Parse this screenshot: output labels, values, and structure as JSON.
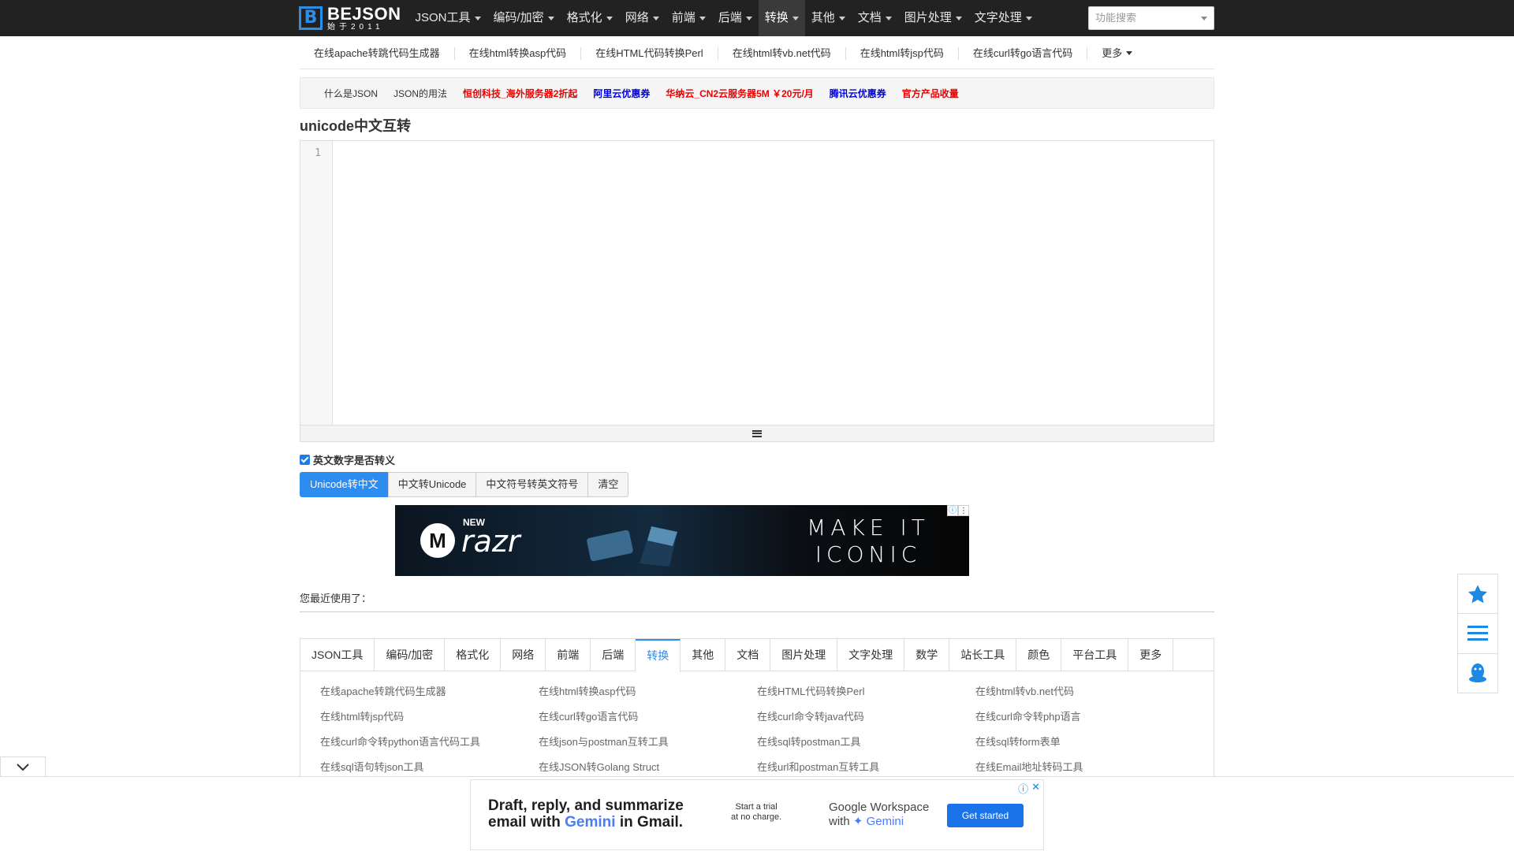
{
  "logo": {
    "main": "BEJSON",
    "sub": "始于2011",
    "mark": "B"
  },
  "nav": {
    "items": [
      {
        "label": "JSON工具"
      },
      {
        "label": "编码/加密"
      },
      {
        "label": "格式化"
      },
      {
        "label": "网络"
      },
      {
        "label": "前端"
      },
      {
        "label": "后端"
      },
      {
        "label": "转换",
        "active": true
      },
      {
        "label": "其他"
      },
      {
        "label": "文档"
      },
      {
        "label": "图片处理"
      },
      {
        "label": "文字处理"
      }
    ],
    "search_placeholder": "功能搜索"
  },
  "subnav": {
    "links": [
      "在线apache转跳代码生成器",
      "在线html转换asp代码",
      "在线HTML代码转换Perl",
      "在线html转vb.net代码",
      "在线html转jsp代码",
      "在线curl转go语言代码"
    ],
    "more": "更多"
  },
  "notice": {
    "what_is_json": "什么是JSON",
    "json_usage": "JSON的用法",
    "promo1": "恒创科技_海外服务器2折起",
    "promo2": "阿里云优惠券",
    "promo3": "华纳云_CN2云服务器5M ￥20元/月",
    "promo4": "腾讯云优惠券",
    "promo5": "官方产品收量"
  },
  "page_title": "unicode中文互转",
  "editor": {
    "line_number": "1",
    "value": ""
  },
  "options": {
    "escape_alnum_label": "英文数字是否转义",
    "escape_alnum_checked": true
  },
  "buttons": {
    "unicode_to_cn": "Unicode转中文",
    "cn_to_unicode": "中文转Unicode",
    "cn_symbol_to_en": "中文符号转英文符号",
    "clear": "清空"
  },
  "ad_top": {
    "new": "NEW",
    "brand": "razr",
    "slogan1": "MAKE IT",
    "slogan2": "ICONIC"
  },
  "recent_label": "您最近使用了：",
  "tabs": [
    "JSON工具",
    "编码/加密",
    "格式化",
    "网络",
    "前端",
    "后端",
    "转换",
    "其他",
    "文档",
    "图片处理",
    "文字处理",
    "数学",
    "站长工具",
    "颜色",
    "平台工具",
    "更多"
  ],
  "active_tab": "转换",
  "tool_links": [
    "在线apache转跳代码生成器",
    "在线html转换asp代码",
    "在线HTML代码转换Perl",
    "在线html转vb.net代码",
    "在线html转jsp代码",
    "在线curl转go语言代码",
    "在线curl命令转java代码",
    "在线curl命令转php语言",
    "在线curl命令转python语言代码工具",
    "在线json与postman互转工具",
    "在线sql转postman工具",
    "在线sql转form表单",
    "在线sql语句转json工具",
    "在线JSON转Golang Struct",
    "在线url和postman互转工具",
    "在线Email地址转码工具"
  ],
  "ad_bottom": {
    "line1": "Draft, reply, and summarize",
    "line2_pre": "email with ",
    "line2_gem": "Gemini",
    "line2_post": " in Gmail.",
    "trial1": "Start a trial",
    "trial2": "at no charge.",
    "gw1": "Google Workspace",
    "gw2_pre": "with ",
    "gw2_gem": "✦ Gemini",
    "cta": "Get started"
  },
  "colors": {
    "accent": "#2d8cf0",
    "navbar": "#222222",
    "promo_red": "#ee0000",
    "promo_blue": "#0000dd"
  }
}
